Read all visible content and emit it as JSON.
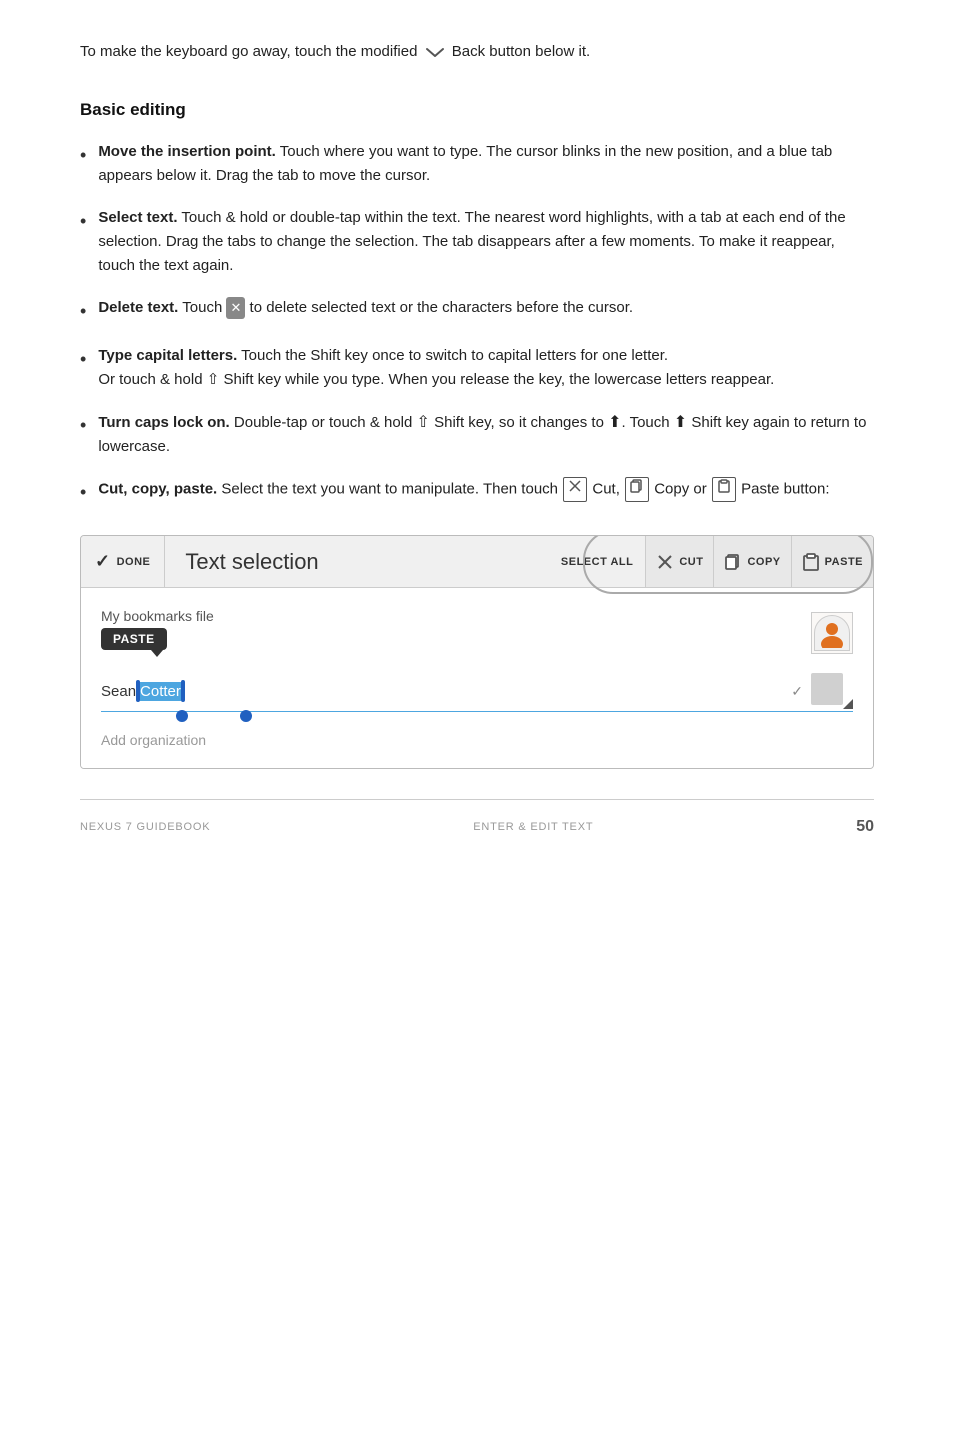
{
  "intro": {
    "text": "To make the keyboard go away, touch the modified",
    "text2": "Back button below it."
  },
  "section": {
    "title": "Basic editing"
  },
  "bullets": [
    {
      "id": "move",
      "bold": "Move the insertion point.",
      "rest": " Touch where you want to type. The cursor blinks in the new position, and a blue tab appears below it. Drag the tab to move the cursor."
    },
    {
      "id": "select",
      "bold": "Select text.",
      "rest": " Touch & hold or double-tap within the text. The nearest word highlights, with a tab at each end of the selection. Drag the tabs to change the selection. The tab disappears after a few moments. To make it reappear, touch the text again."
    },
    {
      "id": "delete",
      "bold": "Delete text.",
      "rest_before": " Touch ",
      "rest_after": " to delete selected text or the characters before the cursor."
    },
    {
      "id": "capital",
      "bold": "Type capital letters.",
      "rest": " Touch the Shift key once to switch to capital letters for one letter.",
      "rest2": "Or touch & hold",
      "rest2b": "Shift key while you type. When you release the key, the lowercase letters reappear."
    },
    {
      "id": "caps",
      "bold": "Turn caps lock on.",
      "rest": " Double-tap or touch & hold",
      "rest2": "Shift key, so it changes to",
      "rest3": ". Touch",
      "rest4": "Shift key again to return to lowercase."
    },
    {
      "id": "cut",
      "bold": "Cut, copy, paste.",
      "rest": " Select the text you want to manipulate. Then touch",
      "cut_label": "Cut,",
      "copy_label": "Copy or",
      "paste_label": "Paste button:"
    }
  ],
  "toolbar": {
    "done_label": "DONE",
    "text_selection_label": "Text selection",
    "select_all_label": "SELECT ALL",
    "cut_label": "CUT",
    "copy_label": "COPY",
    "paste_label": "PASTE"
  },
  "contact_form": {
    "file_text": "My bookmarks file",
    "paste_label": "PASTE",
    "name_prefix": "Sean ",
    "name_selected": "Cotter",
    "add_org": "Add organization"
  },
  "footer": {
    "left": "NEXUS 7 GUIDEBOOK",
    "center": "ENTER & EDIT TEXT",
    "page": "50"
  }
}
